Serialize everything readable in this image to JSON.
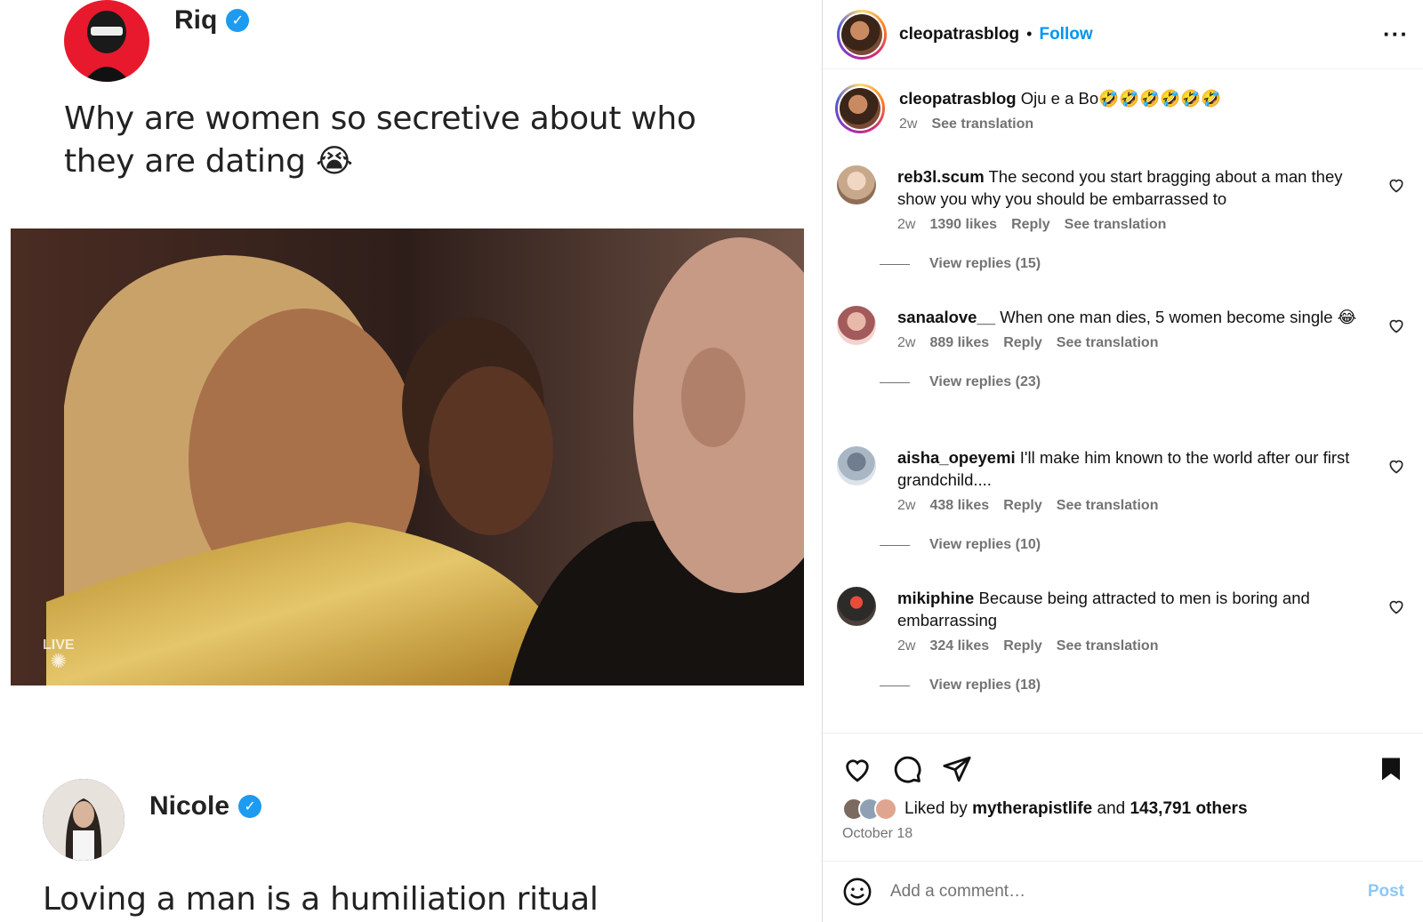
{
  "media": {
    "tweet1": {
      "name": "Riq",
      "verified_mark": "✓",
      "text": "Why are women so secretive about who they are dating 😭"
    },
    "tweet2": {
      "name": "Nicole",
      "verified_mark": "✓",
      "text": "Loving a man is a humiliation ritual"
    },
    "photo_logo": {
      "line1": "LIVE"
    }
  },
  "panel": {
    "header": {
      "username": "cleopatrasblog",
      "separator": "•",
      "follow": "Follow",
      "more": "···"
    },
    "caption": {
      "username": "cleopatrasblog",
      "text": "Oju e a Bo🤣🤣🤣🤣🤣🤣",
      "time": "2w",
      "see_translation": "See translation"
    },
    "comments": [
      {
        "username": "reb3l.scum",
        "text": "The second you start bragging about a man they show you why you should be embarrassed to",
        "time": "2w",
        "likes": "1390 likes",
        "reply": "Reply",
        "see_translation": "See translation",
        "view_replies": "View replies (15)"
      },
      {
        "username": "sanaalove__",
        "text": "When one man dies, 5 women become single 😂",
        "time": "2w",
        "likes": "889 likes",
        "reply": "Reply",
        "see_translation": "See translation",
        "view_replies": "View replies (23)"
      },
      {
        "username": "aisha_opeyemi",
        "text": "I'll make him known to the world after our first grandchild....",
        "time": "2w",
        "likes": "438 likes",
        "reply": "Reply",
        "see_translation": "See translation",
        "view_replies": "View replies (10)"
      },
      {
        "username": "mikiphine",
        "text": "Because being attracted to men is boring and embarrassing",
        "time": "2w",
        "likes": "324 likes",
        "reply": "Reply",
        "see_translation": "See translation",
        "view_replies": "View replies (18)"
      }
    ],
    "likes": {
      "prefix": "Liked by",
      "user": "mytherapistlife",
      "and": "and",
      "others": "143,791 others"
    },
    "date": "October 18",
    "add_comment": {
      "placeholder": "Add a comment…",
      "post": "Post"
    }
  },
  "colors": {
    "follow": "#0095f6",
    "verified": "#1d9bf0",
    "muted": "#737373"
  },
  "icons": [
    "heart-icon",
    "comment-icon",
    "share-icon",
    "bookmark-icon",
    "emoji-icon",
    "more-icon",
    "verified-icon"
  ]
}
